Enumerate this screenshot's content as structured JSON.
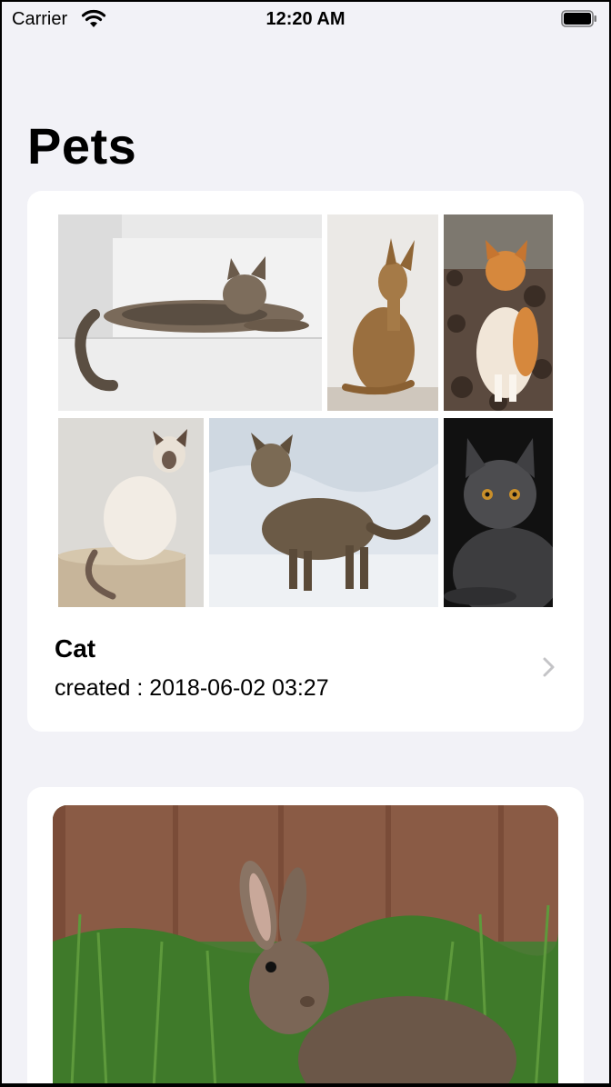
{
  "status_bar": {
    "carrier": "Carrier",
    "time": "12:20 AM",
    "wifi_icon": "wifi-icon",
    "battery_icon": "battery-full-icon"
  },
  "navigation": {
    "title": "Pets"
  },
  "albums": [
    {
      "title": "Cat",
      "subtitle": "created : 2018-06-02 03:27",
      "disclosure_icon": "chevron-right-icon",
      "photo_count": 6
    },
    {
      "title": "",
      "photo_count": 1
    }
  ],
  "colors": {
    "background": "#f2f2f7",
    "card": "#ffffff",
    "chevron": "#c4c4c7"
  }
}
